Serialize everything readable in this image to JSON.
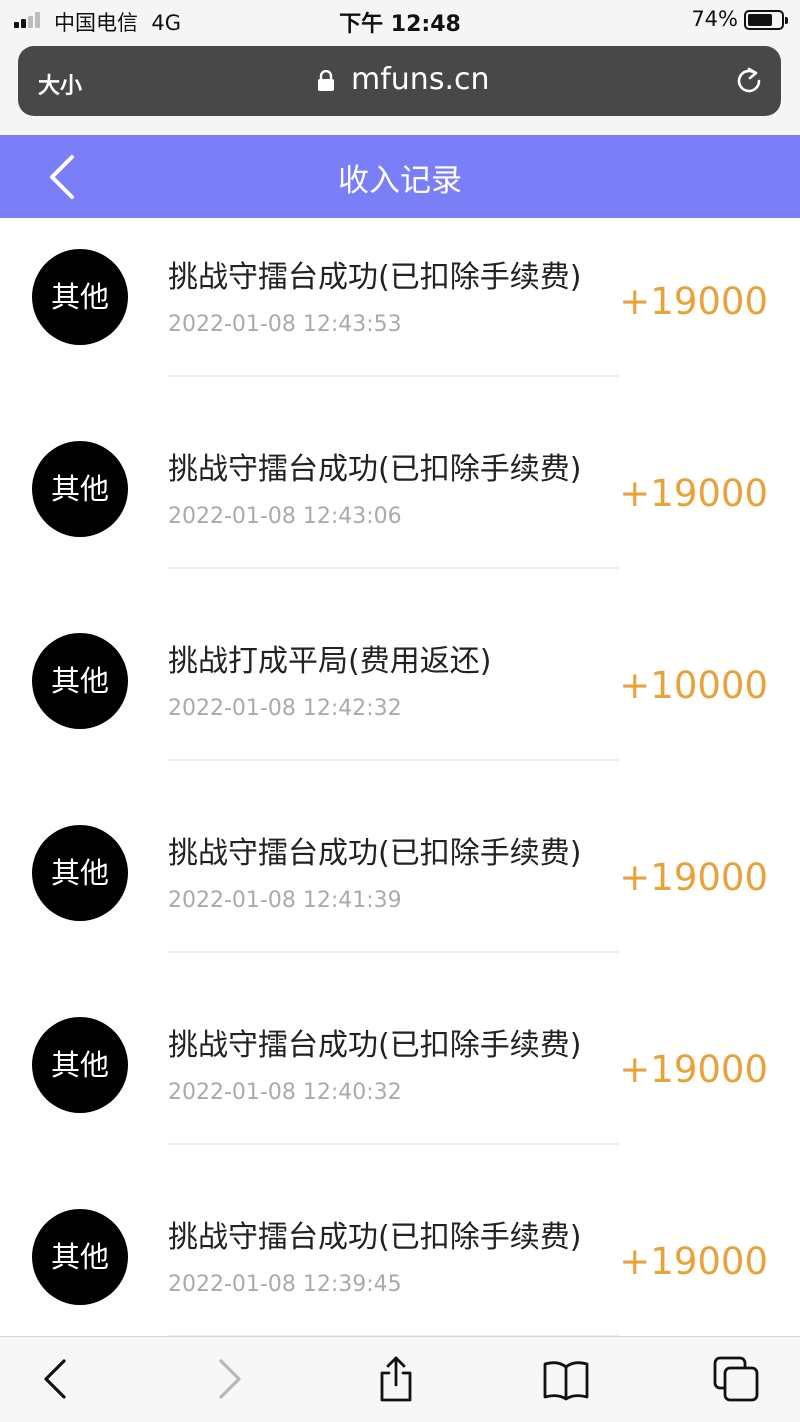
{
  "status_bar": {
    "carrier": "中国电信",
    "network": "4G",
    "time": "下午 12:48",
    "battery": "74%",
    "battery_level": 0.74,
    "signal_bars": 2
  },
  "browser": {
    "text_size": "大小",
    "domain": "mfuns.cn"
  },
  "header": {
    "title": "收入记录"
  },
  "records": [
    {
      "badge": "其他",
      "title": "挑战守擂台成功(已扣除手续费)",
      "time": "2022-01-08 12:43:53",
      "amount": "+19000"
    },
    {
      "badge": "其他",
      "title": "挑战守擂台成功(已扣除手续费)",
      "time": "2022-01-08 12:43:06",
      "amount": "+19000"
    },
    {
      "badge": "其他",
      "title": "挑战打成平局(费用返还)",
      "time": "2022-01-08 12:42:32",
      "amount": "+10000"
    },
    {
      "badge": "其他",
      "title": "挑战守擂台成功(已扣除手续费)",
      "time": "2022-01-08 12:41:39",
      "amount": "+19000"
    },
    {
      "badge": "其他",
      "title": "挑战守擂台成功(已扣除手续费)",
      "time": "2022-01-08 12:40:32",
      "amount": "+19000"
    },
    {
      "badge": "其他",
      "title": "挑战守擂台成功(已扣除手续费)",
      "time": "2022-01-08 12:39:45",
      "amount": "+19000"
    }
  ],
  "colors": {
    "header_bg": "#7b7ff7",
    "amount": "#e9a23b",
    "avatar_bg": "#000000",
    "timestamp": "#aaaaaa"
  },
  "icons": {
    "back": "chevron-left-icon",
    "lock": "lock-icon",
    "reload": "reload-icon",
    "toolbar": [
      "chevron-left-icon",
      "chevron-right-icon",
      "share-icon",
      "book-icon",
      "tabs-icon"
    ]
  }
}
